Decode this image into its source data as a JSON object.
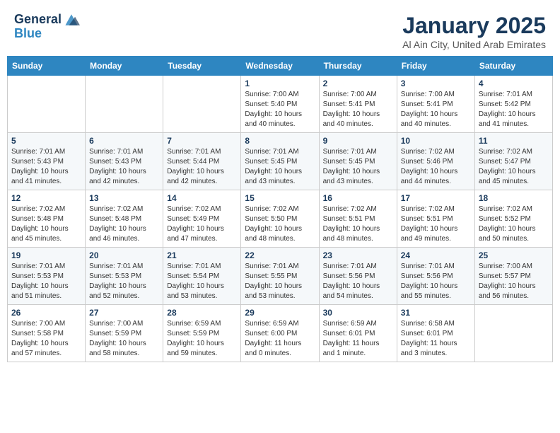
{
  "header": {
    "logo_line1": "General",
    "logo_line2": "Blue",
    "month_title": "January 2025",
    "subtitle": "Al Ain City, United Arab Emirates"
  },
  "weekdays": [
    "Sunday",
    "Monday",
    "Tuesday",
    "Wednesday",
    "Thursday",
    "Friday",
    "Saturday"
  ],
  "weeks": [
    [
      {
        "day": "",
        "info": ""
      },
      {
        "day": "",
        "info": ""
      },
      {
        "day": "",
        "info": ""
      },
      {
        "day": "1",
        "info": "Sunrise: 7:00 AM\nSunset: 5:40 PM\nDaylight: 10 hours\nand 40 minutes."
      },
      {
        "day": "2",
        "info": "Sunrise: 7:00 AM\nSunset: 5:41 PM\nDaylight: 10 hours\nand 40 minutes."
      },
      {
        "day": "3",
        "info": "Sunrise: 7:00 AM\nSunset: 5:41 PM\nDaylight: 10 hours\nand 40 minutes."
      },
      {
        "day": "4",
        "info": "Sunrise: 7:01 AM\nSunset: 5:42 PM\nDaylight: 10 hours\nand 41 minutes."
      }
    ],
    [
      {
        "day": "5",
        "info": "Sunrise: 7:01 AM\nSunset: 5:43 PM\nDaylight: 10 hours\nand 41 minutes."
      },
      {
        "day": "6",
        "info": "Sunrise: 7:01 AM\nSunset: 5:43 PM\nDaylight: 10 hours\nand 42 minutes."
      },
      {
        "day": "7",
        "info": "Sunrise: 7:01 AM\nSunset: 5:44 PM\nDaylight: 10 hours\nand 42 minutes."
      },
      {
        "day": "8",
        "info": "Sunrise: 7:01 AM\nSunset: 5:45 PM\nDaylight: 10 hours\nand 43 minutes."
      },
      {
        "day": "9",
        "info": "Sunrise: 7:01 AM\nSunset: 5:45 PM\nDaylight: 10 hours\nand 43 minutes."
      },
      {
        "day": "10",
        "info": "Sunrise: 7:02 AM\nSunset: 5:46 PM\nDaylight: 10 hours\nand 44 minutes."
      },
      {
        "day": "11",
        "info": "Sunrise: 7:02 AM\nSunset: 5:47 PM\nDaylight: 10 hours\nand 45 minutes."
      }
    ],
    [
      {
        "day": "12",
        "info": "Sunrise: 7:02 AM\nSunset: 5:48 PM\nDaylight: 10 hours\nand 45 minutes."
      },
      {
        "day": "13",
        "info": "Sunrise: 7:02 AM\nSunset: 5:48 PM\nDaylight: 10 hours\nand 46 minutes."
      },
      {
        "day": "14",
        "info": "Sunrise: 7:02 AM\nSunset: 5:49 PM\nDaylight: 10 hours\nand 47 minutes."
      },
      {
        "day": "15",
        "info": "Sunrise: 7:02 AM\nSunset: 5:50 PM\nDaylight: 10 hours\nand 48 minutes."
      },
      {
        "day": "16",
        "info": "Sunrise: 7:02 AM\nSunset: 5:51 PM\nDaylight: 10 hours\nand 48 minutes."
      },
      {
        "day": "17",
        "info": "Sunrise: 7:02 AM\nSunset: 5:51 PM\nDaylight: 10 hours\nand 49 minutes."
      },
      {
        "day": "18",
        "info": "Sunrise: 7:02 AM\nSunset: 5:52 PM\nDaylight: 10 hours\nand 50 minutes."
      }
    ],
    [
      {
        "day": "19",
        "info": "Sunrise: 7:01 AM\nSunset: 5:53 PM\nDaylight: 10 hours\nand 51 minutes."
      },
      {
        "day": "20",
        "info": "Sunrise: 7:01 AM\nSunset: 5:53 PM\nDaylight: 10 hours\nand 52 minutes."
      },
      {
        "day": "21",
        "info": "Sunrise: 7:01 AM\nSunset: 5:54 PM\nDaylight: 10 hours\nand 53 minutes."
      },
      {
        "day": "22",
        "info": "Sunrise: 7:01 AM\nSunset: 5:55 PM\nDaylight: 10 hours\nand 53 minutes."
      },
      {
        "day": "23",
        "info": "Sunrise: 7:01 AM\nSunset: 5:56 PM\nDaylight: 10 hours\nand 54 minutes."
      },
      {
        "day": "24",
        "info": "Sunrise: 7:01 AM\nSunset: 5:56 PM\nDaylight: 10 hours\nand 55 minutes."
      },
      {
        "day": "25",
        "info": "Sunrise: 7:00 AM\nSunset: 5:57 PM\nDaylight: 10 hours\nand 56 minutes."
      }
    ],
    [
      {
        "day": "26",
        "info": "Sunrise: 7:00 AM\nSunset: 5:58 PM\nDaylight: 10 hours\nand 57 minutes."
      },
      {
        "day": "27",
        "info": "Sunrise: 7:00 AM\nSunset: 5:59 PM\nDaylight: 10 hours\nand 58 minutes."
      },
      {
        "day": "28",
        "info": "Sunrise: 6:59 AM\nSunset: 5:59 PM\nDaylight: 10 hours\nand 59 minutes."
      },
      {
        "day": "29",
        "info": "Sunrise: 6:59 AM\nSunset: 6:00 PM\nDaylight: 11 hours\nand 0 minutes."
      },
      {
        "day": "30",
        "info": "Sunrise: 6:59 AM\nSunset: 6:01 PM\nDaylight: 11 hours\nand 1 minute."
      },
      {
        "day": "31",
        "info": "Sunrise: 6:58 AM\nSunset: 6:01 PM\nDaylight: 11 hours\nand 3 minutes."
      },
      {
        "day": "",
        "info": ""
      }
    ]
  ]
}
